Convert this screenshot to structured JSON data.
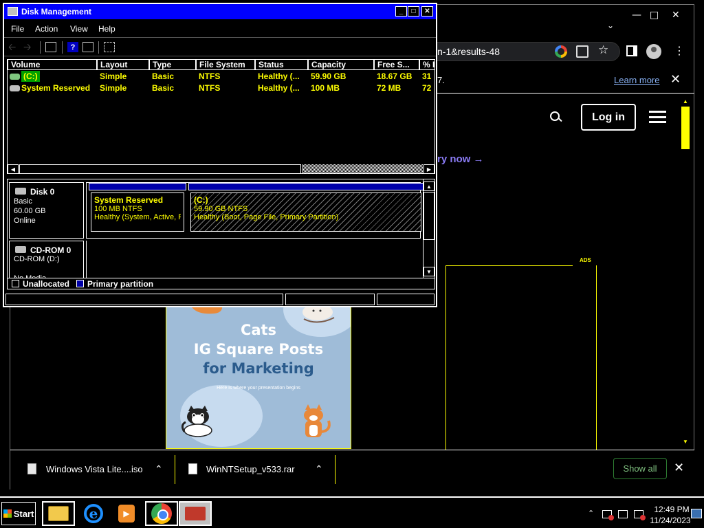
{
  "chrome": {
    "omnibox_text": "n-1&results-48",
    "infobar_text": "7.",
    "learn_more": "Learn more",
    "login": "Log in",
    "try_now": "ry now →",
    "ads_label": "ADS",
    "poster": {
      "title_line1": "Cats",
      "title_line2": "IG Square Posts",
      "title_line3": "for Marketing",
      "subtitle": "Here is where your presentation begins"
    },
    "downloads": [
      {
        "name": "Windows Vista Lite....iso",
        "icon": "iso-file-icon"
      },
      {
        "name": "WinNTSetup_v533.rar",
        "icon": "file-icon"
      }
    ],
    "show_all": "Show all"
  },
  "disk_mgmt": {
    "title": "Disk Management",
    "menu": [
      "File",
      "Action",
      "View",
      "Help"
    ],
    "columns": [
      "Volume",
      "Layout",
      "Type",
      "File System",
      "Status",
      "Capacity",
      "Free S...",
      "% I"
    ],
    "volumes": [
      {
        "volume": "(C:)",
        "layout": "Simple",
        "type": "Basic",
        "fs": "NTFS",
        "status": "Healthy (...",
        "capacity": "59.90 GB",
        "free": "18.67 GB",
        "pct": "31"
      },
      {
        "volume": "System Reserved",
        "layout": "Simple",
        "type": "Basic",
        "fs": "NTFS",
        "status": "Healthy (...",
        "capacity": "100 MB",
        "free": "72 MB",
        "pct": "72"
      }
    ],
    "disks": [
      {
        "name": "Disk 0",
        "kind": "Basic",
        "size": "60.00 GB",
        "state": "Online"
      },
      {
        "name": "CD-ROM 0",
        "kind": "CD-ROM (D:)",
        "size": "",
        "state": "No Media"
      }
    ],
    "partitions": [
      {
        "name": "System Reserved",
        "size_fs": "100 MB NTFS",
        "status": "Healthy (System, Active, Pr"
      },
      {
        "name": "(C:)",
        "size_fs": "59.90 GB NTFS",
        "status": "Healthy (Boot, Page File, Primary Partition)"
      }
    ],
    "legend": [
      "Unallocated",
      "Primary partition"
    ]
  },
  "taskbar": {
    "start": "Start",
    "time": "12:49 PM",
    "date": "11/24/2023"
  },
  "colors": {
    "titlebar": "#0000ff",
    "highlight_text": "#ffff00",
    "primary_partition": "#0000a8"
  }
}
